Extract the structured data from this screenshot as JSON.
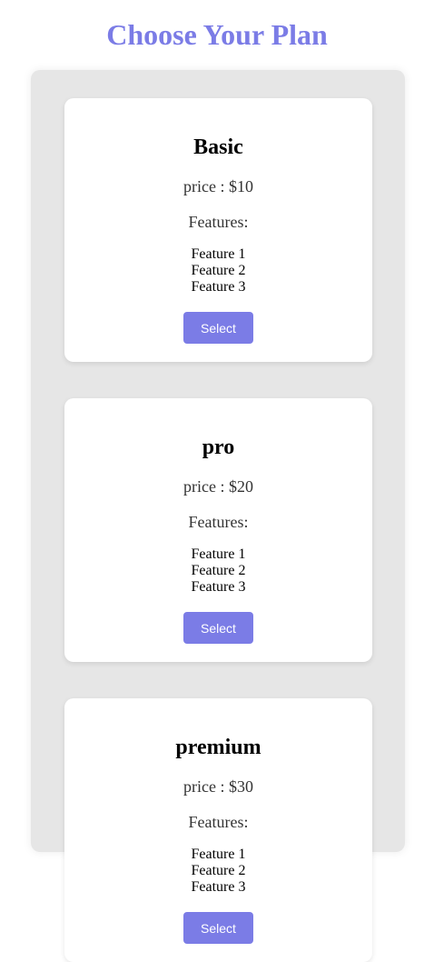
{
  "page": {
    "title": "Choose Your Plan"
  },
  "colors": {
    "accent": "#7b7ce6",
    "panel_bg": "#e6e6e6",
    "card_bg": "#ffffff"
  },
  "plans": [
    {
      "name": "Basic",
      "price": "price : $10",
      "features_heading": "Features:",
      "features": [
        "Feature 1",
        "Feature 2",
        "Feature 3"
      ],
      "button_label": "Select"
    },
    {
      "name": "pro",
      "price": "price : $20",
      "features_heading": "Features:",
      "features": [
        "Feature 1",
        "Feature 2",
        "Feature 3"
      ],
      "button_label": "Select"
    },
    {
      "name": "premium",
      "price": "price : $30",
      "features_heading": "Features:",
      "features": [
        "Feature 1",
        "Feature 2",
        "Feature 3"
      ],
      "button_label": "Select"
    }
  ]
}
